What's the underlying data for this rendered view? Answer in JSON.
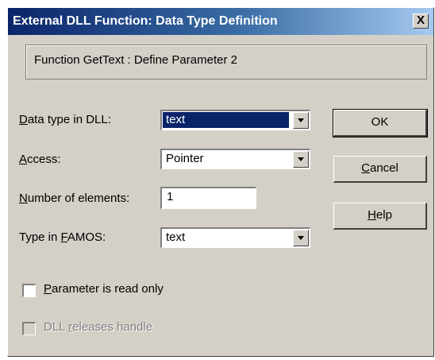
{
  "window": {
    "title": "External DLL Function: Data Type Definition",
    "close_symbol": "X",
    "close_icon": "close-x-icon"
  },
  "header": {
    "text": "Function GetText : Define Parameter 2"
  },
  "fields": {
    "data_type": {
      "label_underline": "D",
      "label_rest": "ata type in DLL:",
      "value": "text"
    },
    "access": {
      "label_underline": "A",
      "label_rest": "ccess:",
      "value": "Pointer"
    },
    "num_elements": {
      "label_underline": "N",
      "label_rest": "umber of elements:",
      "value": "1"
    },
    "famos_type": {
      "label_prefix": "Type in ",
      "label_underline": "F",
      "label_rest": "AMOS:",
      "value": "text"
    }
  },
  "buttons": {
    "ok": "OK",
    "cancel_underline": "C",
    "cancel_rest": "ancel",
    "help_underline": "H",
    "help_rest": "elp"
  },
  "checkboxes": {
    "read_only": {
      "label_underline": "P",
      "label_rest": "arameter is read only",
      "checked": false
    },
    "dll_releases": {
      "label_prefix": "DLL ",
      "label_underline": "r",
      "label_rest": "eleases handle",
      "checked": false,
      "enabled": false
    }
  },
  "colors": {
    "title_gradient_start": "#0a246a",
    "dialog_face": "#d4d0c8",
    "selection": "#0a246a"
  }
}
